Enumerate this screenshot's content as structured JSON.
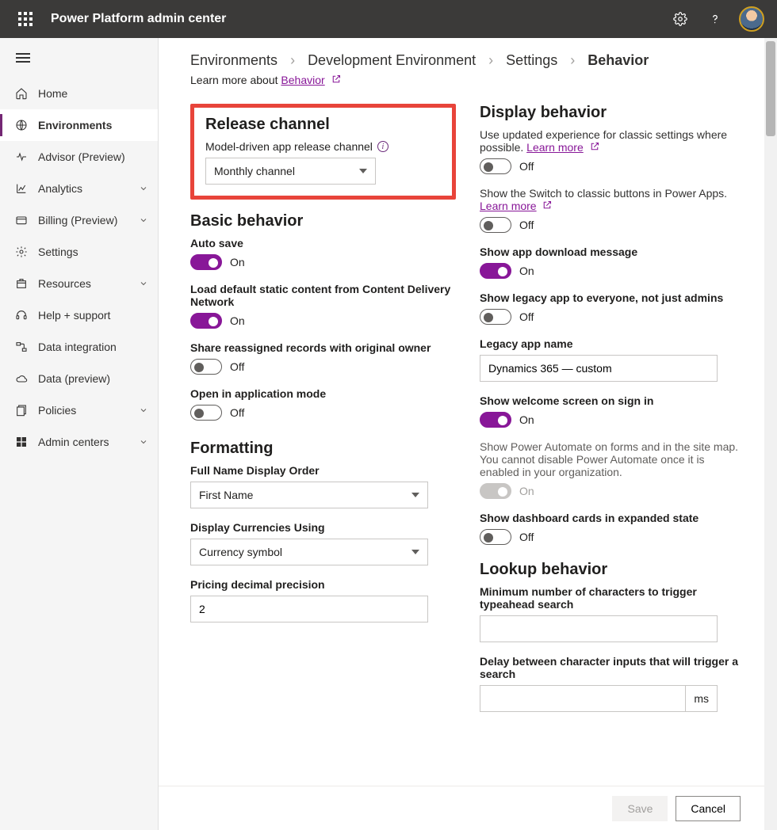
{
  "topbar": {
    "title": "Power Platform admin center"
  },
  "nav": {
    "items": [
      {
        "label": "Home",
        "icon": "home"
      },
      {
        "label": "Environments",
        "icon": "globe",
        "active": true
      },
      {
        "label": "Advisor (Preview)",
        "icon": "pulse"
      },
      {
        "label": "Analytics",
        "icon": "chart",
        "chev": true
      },
      {
        "label": "Billing (Preview)",
        "icon": "card",
        "chev": true
      },
      {
        "label": "Settings",
        "icon": "gear"
      },
      {
        "label": "Resources",
        "icon": "package",
        "chev": true
      },
      {
        "label": "Help + support",
        "icon": "headset"
      },
      {
        "label": "Data integration",
        "icon": "dataflow"
      },
      {
        "label": "Data (preview)",
        "icon": "cloud"
      },
      {
        "label": "Policies",
        "icon": "policy",
        "chev": true
      },
      {
        "label": "Admin centers",
        "icon": "admin",
        "chev": true
      }
    ]
  },
  "breadcrumbs": [
    "Environments",
    "Development Environment",
    "Settings",
    "Behavior"
  ],
  "learn_more_prefix": "Learn more about ",
  "learn_more_link": "Behavior",
  "toggle_labels": {
    "on": "On",
    "off": "Off"
  },
  "left": {
    "release": {
      "heading": "Release channel",
      "label": "Model-driven app release channel",
      "value": "Monthly channel"
    },
    "basic": {
      "heading": "Basic behavior",
      "auto_save": {
        "label": "Auto save",
        "value": true
      },
      "cdn": {
        "label": "Load default static content from Content Delivery Network",
        "value": true
      },
      "share": {
        "label": "Share reassigned records with original owner",
        "value": false
      },
      "open_app": {
        "label": "Open in application mode",
        "value": false
      }
    },
    "formatting": {
      "heading": "Formatting",
      "fullname": {
        "label": "Full Name Display Order",
        "value": "First Name"
      },
      "currency": {
        "label": "Display Currencies Using",
        "value": "Currency symbol"
      },
      "precision": {
        "label": "Pricing decimal precision",
        "value": "2"
      }
    }
  },
  "right": {
    "display": {
      "heading": "Display behavior",
      "updated": {
        "desc": "Use updated experience for classic settings where possible.",
        "link": "Learn more",
        "value": false
      },
      "switch_classic": {
        "desc": "Show the Switch to classic buttons in Power Apps.",
        "link": "Learn more",
        "value": false
      },
      "download": {
        "label": "Show app download message",
        "value": true
      },
      "legacy_all": {
        "label": "Show legacy app to everyone, not just admins",
        "value": false
      },
      "legacy_name": {
        "label": "Legacy app name",
        "value": "Dynamics 365 — custom"
      },
      "welcome": {
        "label": "Show welcome screen on sign in",
        "value": true
      },
      "automate": {
        "desc": "Show Power Automate on forms and in the site map. You cannot disable Power Automate once it is enabled in your organization.",
        "value": true,
        "disabled": true
      },
      "dashboard": {
        "label": "Show dashboard cards in expanded state",
        "value": false
      }
    },
    "lookup": {
      "heading": "Lookup behavior",
      "minchars": {
        "label": "Minimum number of characters to trigger typeahead search",
        "value": ""
      },
      "delay": {
        "label": "Delay between character inputs that will trigger a search",
        "value": "",
        "suffix": "ms"
      }
    }
  },
  "footer": {
    "save": "Save",
    "cancel": "Cancel"
  }
}
